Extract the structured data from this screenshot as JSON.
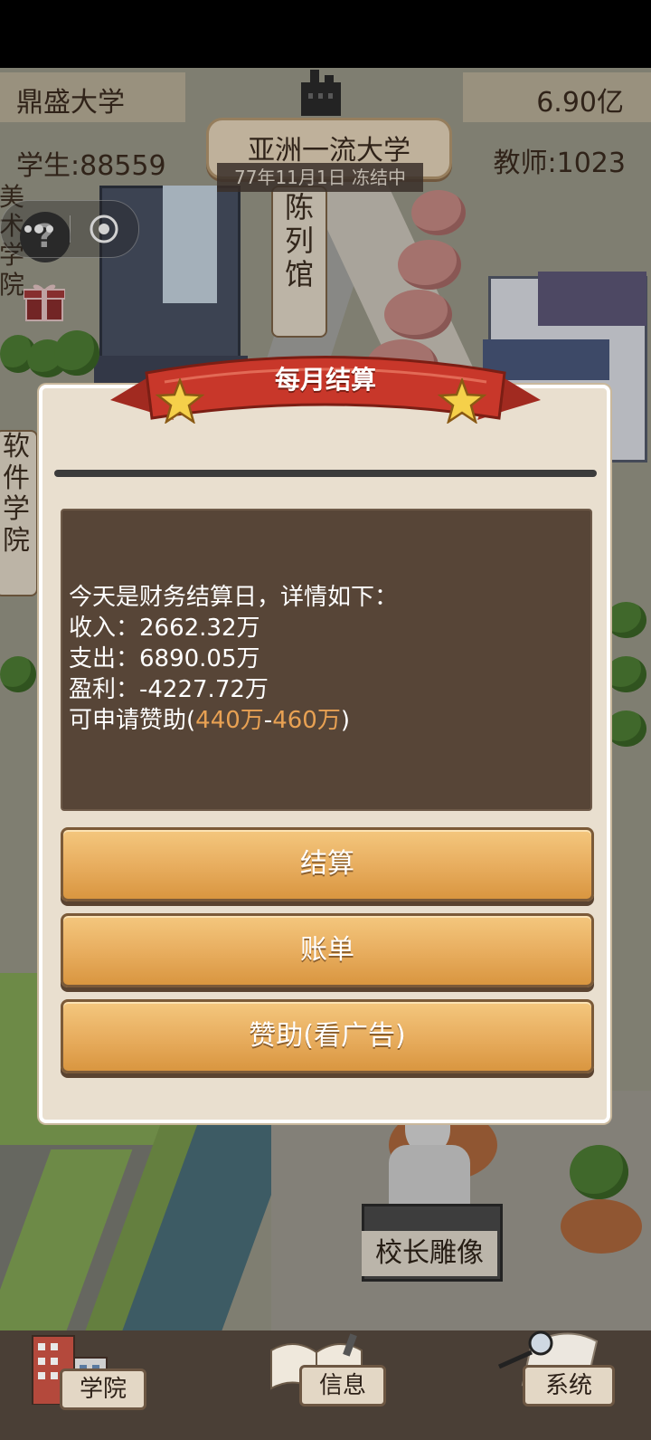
{
  "header": {
    "university_name": "鼎盛大学",
    "funds": "6.90亿",
    "students_label": "学生:88559",
    "teachers_label": "教师:1023",
    "rank_title": "亚洲一流大学",
    "date_status": "77年11月1日 冻结中"
  },
  "map": {
    "sign_exhibition": "陈列馆",
    "sign_art_college": "美术学院",
    "sign_software_college": "软件学院",
    "statue_label": "校长雕像"
  },
  "capsule": {
    "more_icon": "more-dots-icon",
    "close_icon": "target-circle-icon"
  },
  "dialog": {
    "title": "每月结算",
    "report": {
      "line1": "今天是财务结算日，详情如下：",
      "income": "收入：2662.32万",
      "expense": "支出：6890.05万",
      "profit": "盈利：-4227.72万",
      "sponsor_prefix": "可申请赞助(",
      "sponsor_min": "440万",
      "sponsor_dash": "-",
      "sponsor_max": "460万",
      "sponsor_suffix": ")"
    },
    "buttons": {
      "settle": "结算",
      "bills": "账单",
      "sponsor_ad": "赞助(看广告)"
    }
  },
  "bottom_nav": {
    "college": "学院",
    "info": "信息",
    "system": "系统"
  },
  "colors": {
    "dialog_bg": "#e9dfcf",
    "textbox_bg": "#574537",
    "highlight": "#e8a153",
    "button": "#e7ac5d",
    "ribbon": "#c8372a"
  }
}
